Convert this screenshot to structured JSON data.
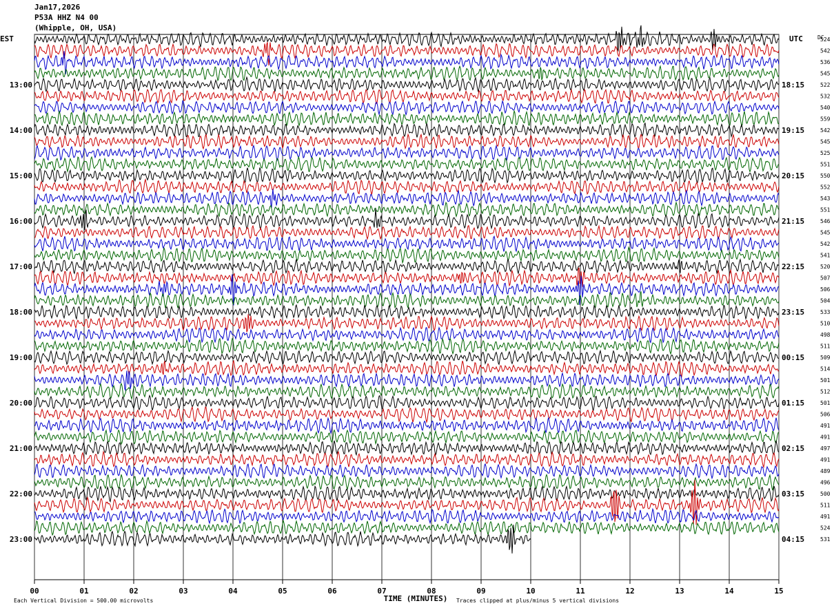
{
  "header": {
    "date": "Jan17,2026",
    "station": "P53A HHZ N4 00",
    "location": "(Whipple, OH, USA)"
  },
  "left_zone": "EST",
  "right_zone": "UTC",
  "dc_label": "DC",
  "footer": {
    "scale": "Each Vertical Division =  500.00 microvolts",
    "xlabel": "TIME (MINUTES)",
    "clip": "Traces clipped at plus/minus 5 vertical divisions"
  },
  "colors": {
    "cycle": [
      "#000000",
      "#cc0000",
      "#0000cc",
      "#006600"
    ]
  },
  "chart_data": {
    "type": "line",
    "title": "P53A HHZ N4 00",
    "xlabel": "TIME (MINUTES)",
    "xlim": [
      0,
      15
    ],
    "x_ticks": [
      "00",
      "01",
      "02",
      "03",
      "04",
      "05",
      "06",
      "07",
      "08",
      "09",
      "10",
      "11",
      "12",
      "13",
      "14",
      "15"
    ],
    "rows": 44,
    "left_hour_labels": [
      {
        "row": 4,
        "text": "13:00"
      },
      {
        "row": 8,
        "text": "14:00"
      },
      {
        "row": 12,
        "text": "15:00"
      },
      {
        "row": 16,
        "text": "16:00"
      },
      {
        "row": 20,
        "text": "17:00"
      },
      {
        "row": 24,
        "text": "18:00"
      },
      {
        "row": 28,
        "text": "19:00"
      },
      {
        "row": 32,
        "text": "20:00"
      },
      {
        "row": 36,
        "text": "21:00"
      },
      {
        "row": 40,
        "text": "22:00"
      },
      {
        "row": 44,
        "text": "23:00"
      }
    ],
    "right_hour_labels": [
      {
        "row": 0,
        "text": "UTC"
      },
      {
        "row": 4,
        "text": "18:15"
      },
      {
        "row": 8,
        "text": "19:15"
      },
      {
        "row": 12,
        "text": "20:15"
      },
      {
        "row": 16,
        "text": "21:15"
      },
      {
        "row": 20,
        "text": "22:15"
      },
      {
        "row": 24,
        "text": "23:15"
      },
      {
        "row": 28,
        "text": "00:15"
      },
      {
        "row": 32,
        "text": "01:15"
      },
      {
        "row": 36,
        "text": "02:15"
      },
      {
        "row": 40,
        "text": "03:15"
      },
      {
        "row": 44,
        "text": "04:15"
      }
    ],
    "dc_offsets": [
      524,
      542,
      536,
      545,
      522,
      532,
      540,
      559,
      542,
      545,
      525,
      551,
      550,
      552,
      543,
      551,
      546,
      545,
      542,
      541,
      520,
      507,
      506,
      504,
      533,
      510,
      498,
      511,
      509,
      514,
      501,
      512,
      501,
      506,
      491,
      491,
      497,
      491,
      489,
      496,
      500,
      511,
      491,
      524,
      531
    ],
    "events": [
      {
        "row": 0,
        "minute": 11.8,
        "amp": 2.5
      },
      {
        "row": 0,
        "minute": 12.2,
        "amp": 2.0
      },
      {
        "row": 0,
        "minute": 13.7,
        "amp": 2.0
      },
      {
        "row": 1,
        "minute": 4.7,
        "amp": 2.0
      },
      {
        "row": 2,
        "minute": 0.6,
        "amp": 1.5
      },
      {
        "row": 3,
        "minute": 10.2,
        "amp": 1.2
      },
      {
        "row": 14,
        "minute": 4.8,
        "amp": 1.5
      },
      {
        "row": 16,
        "minute": 1.0,
        "amp": 2.0
      },
      {
        "row": 16,
        "minute": 6.9,
        "amp": 1.5
      },
      {
        "row": 20,
        "minute": 13.0,
        "amp": 1.2
      },
      {
        "row": 21,
        "minute": 8.6,
        "amp": 1.2
      },
      {
        "row": 21,
        "minute": 11.0,
        "amp": 2.0
      },
      {
        "row": 22,
        "minute": 2.6,
        "amp": 1.5
      },
      {
        "row": 22,
        "minute": 4.0,
        "amp": 2.5
      },
      {
        "row": 22,
        "minute": 11.0,
        "amp": 2.5
      },
      {
        "row": 23,
        "minute": 12.2,
        "amp": 1.2
      },
      {
        "row": 25,
        "minute": 4.3,
        "amp": 2.0
      },
      {
        "row": 29,
        "minute": 2.6,
        "amp": 1.2
      },
      {
        "row": 30,
        "minute": 1.9,
        "amp": 2.0
      },
      {
        "row": 41,
        "minute": 11.7,
        "amp": 4.0
      },
      {
        "row": 41,
        "minute": 13.3,
        "amp": 4.5
      },
      {
        "row": 44,
        "minute": 9.6,
        "amp": 3.0
      }
    ],
    "last_row_end_minute": 10.0
  }
}
